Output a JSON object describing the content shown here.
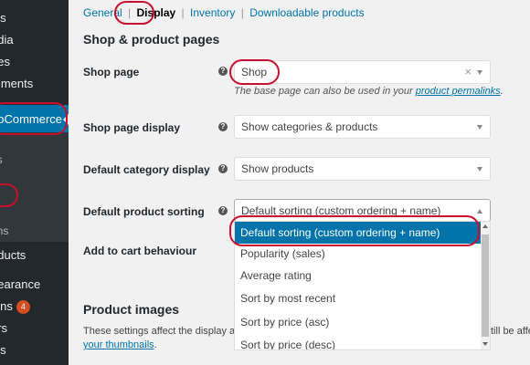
{
  "sidebar": {
    "items": [
      {
        "label": "sts"
      },
      {
        "label": "edia"
      },
      {
        "label": "ges"
      },
      {
        "label": "mments"
      },
      {
        "label": "ooCommerce"
      },
      {
        "label": "ns"
      },
      {
        "label": "s"
      },
      {
        "label": "s"
      },
      {
        "label": "ons"
      },
      {
        "label": "oducts"
      },
      {
        "label": "pearance"
      },
      {
        "label": "gins"
      },
      {
        "label": "ers"
      },
      {
        "label": "ols"
      }
    ],
    "plugins_badge": "4"
  },
  "subnav": {
    "general": "General",
    "display": "Display",
    "inventory": "Inventory",
    "downloadable": "Downloadable products",
    "sep": "|"
  },
  "section1": {
    "title": "Shop & product pages",
    "shop_page": {
      "label": "Shop page",
      "value": "Shop",
      "desc_prefix": "The base page can also be used in your ",
      "desc_link": "product permalinks",
      "desc_suffix": "."
    },
    "shop_page_display": {
      "label": "Shop page display",
      "value": "Show categories & products"
    },
    "default_category_display": {
      "label": "Default category display",
      "value": "Show products"
    },
    "default_product_sorting": {
      "label": "Default product sorting",
      "value": "Default sorting (custom ordering + name)"
    },
    "add_to_cart": {
      "label": "Add to cart behaviour"
    }
  },
  "dropdown": {
    "options": [
      "Default sorting (custom ordering + name)",
      "Popularity (sales)",
      "Average rating",
      "Sort by most recent",
      "Sort by price (asc)",
      "Sort by price (desc)"
    ]
  },
  "section2": {
    "title": "Product images",
    "para_left": "These settings affect the display and dim",
    "para_right": "till be affec",
    "link": "your thumbnails",
    "link_suffix": "."
  },
  "help_glyph": "?",
  "clear_glyph": "×",
  "colors": {
    "accent": "#0073aa",
    "annotation": "#c8102e",
    "sidebar": "#23282d"
  }
}
